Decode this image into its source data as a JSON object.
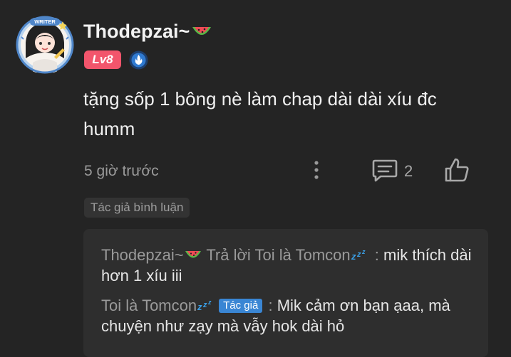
{
  "comment": {
    "author": {
      "name": "Thodepzai~",
      "name_emoji": "watermelon-icon",
      "level": "Lv8",
      "avatar_frame_label": "WRITER",
      "verify_badge": "verified-badge-icon"
    },
    "text": "tặng sốp 1 bông nè làm chap dài dài xíu đc humm",
    "timestamp": "5 giờ trước",
    "reply_count": "2",
    "author_comment_tag": "Tác giả bình luận"
  },
  "replies": [
    {
      "user": "Thodepzai~",
      "user_emoji": "watermelon-icon",
      "action": "Trả lời",
      "target": "Toi là Tomcon",
      "target_emoji": "zzz-icon",
      "separator": ":",
      "text": "mik thích dài hơn 1 xíu iii"
    },
    {
      "user": "Toi là Tomcon",
      "user_emoji": "zzz-icon",
      "badge": "Tác giả",
      "separator": ":",
      "text": "Mik cảm ơn bạn ạaa, mà chuyện như zạy mà vẫy hok dài hỏ"
    }
  ],
  "colors": {
    "background": "#242424",
    "level_badge": "#f2556c",
    "author_badge": "#3a86d4",
    "reply_box": "#2e2e2e"
  }
}
